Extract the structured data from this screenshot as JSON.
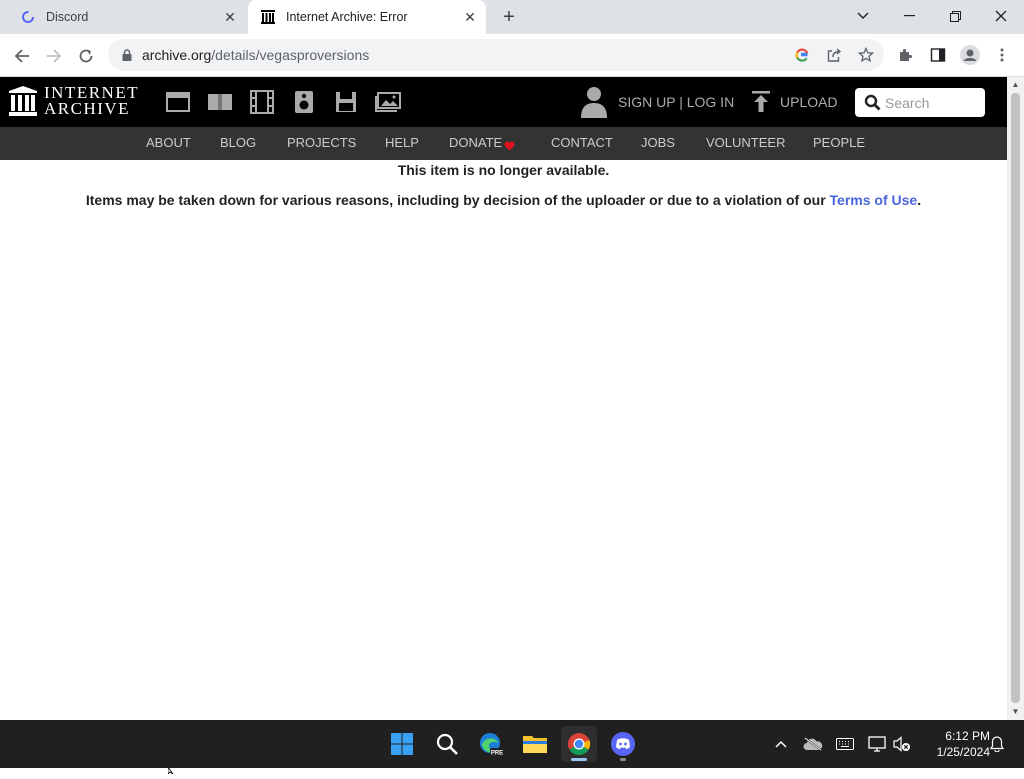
{
  "browser": {
    "tabs": [
      {
        "title": "Discord",
        "icon": "discord-favicon"
      },
      {
        "title": "Internet Archive: Error",
        "icon": "archive-favicon"
      }
    ],
    "url_domain": "archive.org",
    "url_path": "/details/vegasproversions"
  },
  "ia": {
    "logo_line1": "INTERNET",
    "logo_line2": "ARCHIVE",
    "auth": "SIGN UP | LOG IN",
    "upload": "UPLOAD",
    "search_placeholder": "Search",
    "nav": [
      "ABOUT",
      "BLOG",
      "PROJECTS",
      "HELP",
      "DONATE",
      "CONTACT",
      "JOBS",
      "VOLUNTEER",
      "PEOPLE"
    ]
  },
  "content": {
    "heading": "This item is no longer available.",
    "body_before": "Items may be taken down for various reasons, including by decision of the uploader or due to a violation of our ",
    "link": "Terms of Use",
    "body_after": "."
  },
  "taskbar": {
    "time": "6:12 PM",
    "date": "1/25/2024"
  },
  "colors": {
    "ia_black": "#000000",
    "ia_nav": "#333333",
    "link": "#4b64de",
    "taskbar": "#202020"
  }
}
